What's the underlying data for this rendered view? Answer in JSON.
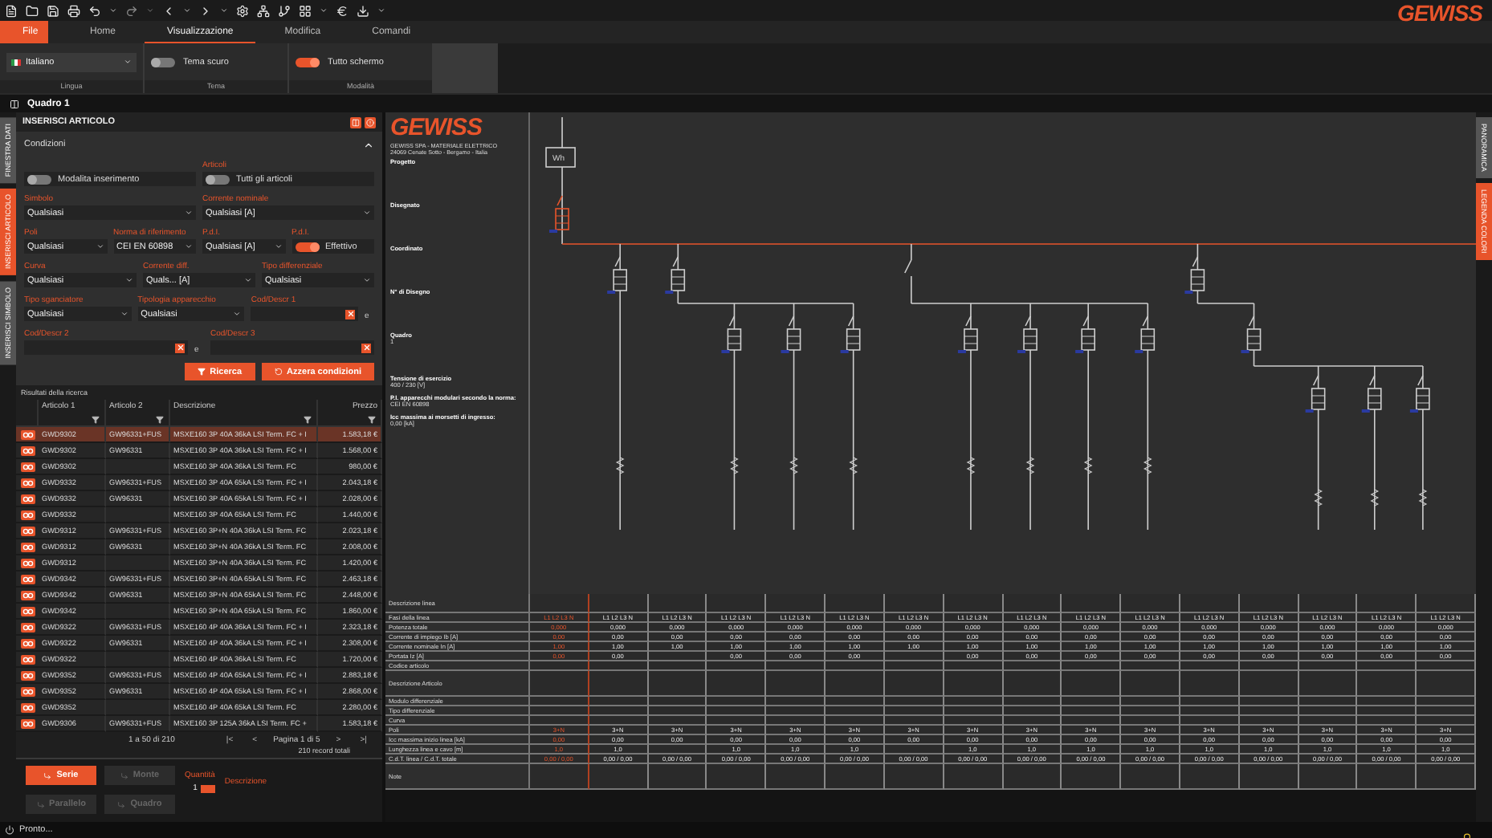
{
  "logo": "GEWISS",
  "ribbon": {
    "tabs": [
      {
        "label": "File",
        "kind": "file",
        "selected": false
      },
      {
        "label": "Home",
        "kind": "tab",
        "selected": false
      },
      {
        "label": "Visualizzazione",
        "kind": "tab",
        "selected": true
      },
      {
        "label": "Modifica",
        "kind": "tab",
        "selected": false
      },
      {
        "label": "Comandi",
        "kind": "tab",
        "selected": false
      }
    ],
    "groups": [
      {
        "label": "Lingua",
        "control": {
          "kind": "select",
          "value": "Italiano"
        }
      },
      {
        "label": "Tema",
        "control": {
          "kind": "toggle",
          "text": "Tema scuro",
          "on": false
        }
      },
      {
        "label": "Modalità",
        "control": {
          "kind": "toggle",
          "text": "Tutto schermo",
          "on": true
        }
      }
    ]
  },
  "document_tab": "Quadro 1",
  "left_tabs": [
    {
      "label": "FINESTRA DATI",
      "selected": false
    },
    {
      "label": "INSERISCI ARTICOLO",
      "selected": true
    },
    {
      "label": "INSERISCI SIMBOLO",
      "selected": false
    }
  ],
  "right_tabs": [
    {
      "label": "PANORAMICA",
      "selected": false
    },
    {
      "label": "LEGENDA COLORI",
      "selected": true
    }
  ],
  "panel": {
    "title": "INSERISCI ARTICOLO",
    "conditions_title": "Condizioni",
    "lines": [
      {
        "fields": [
          {
            "kind": "toggle",
            "text": "Modalita inserimento",
            "on": false
          },
          {
            "kind": "toggle",
            "label": "Articoli",
            "text": "Tutti gli articoli",
            "on": false
          }
        ]
      },
      {
        "fields": [
          {
            "kind": "select",
            "label": "Simbolo",
            "value": "Qualsiasi"
          },
          {
            "kind": "select",
            "label": "Corrente nominale",
            "value": "Qualsiasi [A]"
          }
        ]
      },
      {
        "fields": [
          {
            "kind": "select",
            "label": "Poli",
            "value": "Qualsiasi"
          },
          {
            "kind": "select",
            "label": "Norma di riferimento",
            "value": "CEI EN 60898"
          },
          {
            "kind": "select",
            "label": "P.d.I.",
            "value": "Qualsiasi [A]"
          },
          {
            "kind": "toggle",
            "label": "P.d.I.",
            "text": "Effettivo",
            "on": true
          }
        ]
      },
      {
        "fields": [
          {
            "kind": "select",
            "label": "Curva",
            "value": "Qualsiasi"
          },
          {
            "kind": "select",
            "label": "Corrente diff.",
            "value": "Quals... [A]"
          },
          {
            "kind": "select",
            "label": "Tipo differenziale",
            "value": "Qualsiasi"
          }
        ]
      },
      {
        "fields": [
          {
            "kind": "select",
            "label": "Tipo sganciatore",
            "value": "Qualsiasi"
          },
          {
            "kind": "select",
            "label": "Tipologia apparecchio",
            "value": "Qualsiasi"
          },
          {
            "kind": "text",
            "label": "Cod/Descr 1"
          },
          {
            "kind": "conj",
            "text": "e"
          }
        ]
      },
      {
        "fields": [
          {
            "kind": "text",
            "label": "Cod/Descr 2"
          },
          {
            "kind": "conj",
            "text": "e"
          },
          {
            "kind": "text",
            "label": "Cod/Descr 3"
          }
        ]
      }
    ],
    "buttons": [
      {
        "label": "Ricerca",
        "kind": "search"
      },
      {
        "label": "Azzera condizioni",
        "kind": "reset"
      }
    ],
    "results_title": "Risultati della ricerca",
    "columns": [
      "Articolo 1",
      "Articolo 2",
      "Descrizione",
      "Prezzo"
    ],
    "results": [
      {
        "art1": "GWD9302",
        "art2": "GW96331+FUS",
        "desc": "MSXE160 3P 40A 36kA LSI Term. FC + I",
        "price": "1.583,18 €",
        "selected": true
      },
      {
        "art1": "GWD9302",
        "art2": "GW96331",
        "desc": "MSXE160 3P 40A 36kA LSI Term. FC + I",
        "price": "1.568,00 €",
        "selected": false
      },
      {
        "art1": "GWD9302",
        "desc": "MSXE160 3P 40A 36kA LSI Term. FC",
        "price": "980,00 €",
        "selected": false
      },
      {
        "art1": "GWD9332",
        "art2": "GW96331+FUS",
        "desc": "MSXE160 3P 40A 65kA LSI Term. FC + I",
        "price": "2.043,18 €",
        "selected": false
      },
      {
        "art1": "GWD9332",
        "art2": "GW96331",
        "desc": "MSXE160 3P 40A 65kA LSI Term. FC + I",
        "price": "2.028,00 €",
        "selected": false
      },
      {
        "art1": "GWD9332",
        "desc": "MSXE160 3P 40A 65kA LSI Term. FC",
        "price": "1.440,00 €",
        "selected": false
      },
      {
        "art1": "GWD9312",
        "art2": "GW96331+FUS",
        "desc": "MSXE160 3P+N 40A 36kA LSI Term. FC",
        "price": "2.023,18 €",
        "selected": false
      },
      {
        "art1": "GWD9312",
        "art2": "GW96331",
        "desc": "MSXE160 3P+N 40A 36kA LSI Term. FC",
        "price": "2.008,00 €",
        "selected": false
      },
      {
        "art1": "GWD9312",
        "desc": "MSXE160 3P+N 40A 36kA LSI Term. FC",
        "price": "1.420,00 €",
        "selected": false
      },
      {
        "art1": "GWD9342",
        "art2": "GW96331+FUS",
        "desc": "MSXE160 3P+N 40A 65kA LSI Term. FC",
        "price": "2.463,18 €",
        "selected": false
      },
      {
        "art1": "GWD9342",
        "art2": "GW96331",
        "desc": "MSXE160 3P+N 40A 65kA LSI Term. FC",
        "price": "2.448,00 €",
        "selected": false
      },
      {
        "art1": "GWD9342",
        "desc": "MSXE160 3P+N 40A 65kA LSI Term. FC",
        "price": "1.860,00 €",
        "selected": false
      },
      {
        "art1": "GWD9322",
        "art2": "GW96331+FUS",
        "desc": "MSXE160 4P 40A 36kA LSI Term. FC + I",
        "price": "2.323,18 €",
        "selected": false
      },
      {
        "art1": "GWD9322",
        "art2": "GW96331",
        "desc": "MSXE160 4P 40A 36kA LSI Term. FC + I",
        "price": "2.308,00 €",
        "selected": false
      },
      {
        "art1": "GWD9322",
        "desc": "MSXE160 4P 40A 36kA LSI Term. FC",
        "price": "1.720,00 €",
        "selected": false
      },
      {
        "art1": "GWD9352",
        "art2": "GW96331+FUS",
        "desc": "MSXE160 4P 40A 65kA LSI Term. FC + I",
        "price": "2.883,18 €",
        "selected": false
      },
      {
        "art1": "GWD9352",
        "art2": "GW96331",
        "desc": "MSXE160 4P 40A 65kA LSI Term. FC + I",
        "price": "2.868,00 €",
        "selected": false
      },
      {
        "art1": "GWD9352",
        "desc": "MSXE160 4P 40A 65kA LSI Term. FC",
        "price": "2.280,00 €",
        "selected": false
      },
      {
        "art1": "GWD9306",
        "art2": "GW96331+FUS",
        "desc": "MSXE160 3P 125A 36kA LSI Term. FC +",
        "price": "1.583,18 €",
        "selected": false
      }
    ],
    "pager": {
      "range": "1 a 50 di 210",
      "first": "|<",
      "prev": "<",
      "page": "Pagina 1 di 5",
      "next": ">",
      "last": ">|",
      "total": "210 record totali"
    },
    "connect_buttons": [
      {
        "label": "Serie",
        "selected": true,
        "disabled": false
      },
      {
        "label": "Monte",
        "selected": false,
        "disabled": true
      },
      {
        "label": "Parallelo",
        "selected": false,
        "disabled": true
      },
      {
        "label": "Quadro",
        "selected": false,
        "disabled": true
      }
    ],
    "quantity_label": "Quantità",
    "quantity": "1",
    "description_label": "Descrizione"
  },
  "title_block": {
    "logo": "GEWISS",
    "company": "GEWISS SPA - MATERIALE ELETTRICO",
    "address": "24069 Cenate Sotto - Bergamo - Italia",
    "fields": [
      {
        "label": "Progetto"
      },
      {
        "label": "Disegnato"
      },
      {
        "label": "Coordinato"
      },
      {
        "label": "N° di Disegno"
      },
      {
        "label": "Quadro",
        "value": "1"
      }
    ],
    "specs": [
      {
        "label": "Tensione di esercizio",
        "value": "400 / 230 [V]"
      },
      {
        "label": "P.I. apparecchi modulari secondo la norma:",
        "value": "CEI EN 60898"
      },
      {
        "label": "Icc massima ai morsetti di ingresso:",
        "value": "0,00 [kA]"
      }
    ]
  },
  "meter_label": "Wh",
  "line_table": {
    "rows": [
      {
        "label": "Descrizione linea",
        "kind": "tall"
      },
      {
        "label": "Fasi della linea",
        "kind": "value"
      },
      {
        "label": "Potenza totale",
        "kind": "value"
      },
      {
        "label": "Corrente di impiego Ib [A]",
        "kind": "value"
      },
      {
        "label": "Corrente nominale In [A]",
        "kind": "value"
      },
      {
        "label": "Portata Iz [A]",
        "kind": "value"
      },
      {
        "label": "Codice articolo",
        "kind": "value"
      },
      {
        "label": "Descrizione Articolo",
        "kind": "tall"
      },
      {
        "label": "Modulo differenziale",
        "kind": "value"
      },
      {
        "label": "Tipo differenziale",
        "kind": "value"
      },
      {
        "label": "Curva",
        "kind": "value"
      },
      {
        "label": "Poli",
        "kind": "value"
      },
      {
        "label": "Icc massima inizio linea [kA]",
        "kind": "value"
      },
      {
        "label": "Lunghezza linea e cavo [m]",
        "kind": "value"
      },
      {
        "label": "C.d.T. linea / C.d.T. totale",
        "kind": "value"
      },
      {
        "label": "Note",
        "kind": "tall"
      }
    ],
    "columns": [
      {
        "selected": true,
        "cells": [
          "L1 L2 L3 N",
          "0,000",
          "0,00",
          "1,00",
          "0,00",
          null,
          null,
          null,
          null,
          "3+N",
          "0,00",
          "1,0",
          "0,00 / 0,00"
        ]
      },
      {
        "selected": false,
        "cells": [
          "L1 L2 L3 N",
          "0,000",
          "0,00",
          "1,00",
          "0,00",
          null,
          null,
          null,
          null,
          "3+N",
          "0,00",
          "1,0",
          "0,00 / 0,00"
        ]
      },
      {
        "selected": false,
        "cells": [
          "L1 L2 L3 N",
          "0,000",
          "0,00",
          "1,00",
          null,
          null,
          null,
          null,
          null,
          "3+N",
          "0,00",
          null,
          "0,00 / 0,00"
        ]
      },
      {
        "selected": false,
        "cells": [
          "L1 L2 L3 N",
          "0,000",
          "0,00",
          "1,00",
          "0,00",
          null,
          null,
          null,
          null,
          "3+N",
          "0,00",
          "1,0",
          "0,00 / 0,00"
        ]
      },
      {
        "selected": false,
        "cells": [
          "L1 L2 L3 N",
          "0,000",
          "0,00",
          "1,00",
          "0,00",
          null,
          null,
          null,
          null,
          "3+N",
          "0,00",
          "1,0",
          "0,00 / 0,00"
        ]
      },
      {
        "selected": false,
        "cells": [
          "L1 L2 L3 N",
          "0,000",
          "0,00",
          "1,00",
          "0,00",
          null,
          null,
          null,
          null,
          "3+N",
          "0,00",
          "1,0",
          "0,00 / 0,00"
        ]
      },
      {
        "selected": false,
        "cells": [
          "L1 L2 L3 N",
          "0,000",
          "0,00",
          "1,00",
          null,
          null,
          null,
          null,
          null,
          "3+N",
          "0,00",
          null,
          "0,00 / 0,00"
        ]
      },
      {
        "selected": false,
        "cells": [
          "L1 L2 L3 N",
          "0,000",
          "0,00",
          "1,00",
          "0,00",
          null,
          null,
          null,
          null,
          "3+N",
          "0,00",
          "1,0",
          "0,00 / 0,00"
        ]
      },
      {
        "selected": false,
        "cells": [
          "L1 L2 L3 N",
          "0,000",
          "0,00",
          "1,00",
          "0,00",
          null,
          null,
          null,
          null,
          "3+N",
          "0,00",
          "1,0",
          "0,00 / 0,00"
        ]
      },
      {
        "selected": false,
        "cells": [
          "L1 L2 L3 N",
          "0,000",
          "0,00",
          "1,00",
          "0,00",
          null,
          null,
          null,
          null,
          "3+N",
          "0,00",
          "1,0",
          "0,00 / 0,00"
        ]
      },
      {
        "selected": false,
        "cells": [
          "L1 L2 L3 N",
          "0,000",
          "0,00",
          "1,00",
          "0,00",
          null,
          null,
          null,
          null,
          "3+N",
          "0,00",
          "1,0",
          "0,00 / 0,00"
        ]
      },
      {
        "selected": false,
        "cells": [
          "L1 L2 L3 N",
          "0,000",
          "0,00",
          "1,00",
          "0,00",
          null,
          null,
          null,
          null,
          "3+N",
          "0,00",
          "1,0",
          "0,00 / 0,00"
        ]
      },
      {
        "selected": false,
        "cells": [
          "L1 L2 L3 N",
          "0,000",
          "0,00",
          "1,00",
          "0,00",
          null,
          null,
          null,
          null,
          "3+N",
          "0,00",
          "1,0",
          "0,00 / 0,00"
        ]
      },
      {
        "selected": false,
        "cells": [
          "L1 L2 L3 N",
          "0,000",
          "0,00",
          "1,00",
          "0,00",
          null,
          null,
          null,
          null,
          "3+N",
          "0,00",
          "1,0",
          "0,00 / 0,00"
        ]
      },
      {
        "selected": false,
        "cells": [
          "L1 L2 L3 N",
          "0,000",
          "0,00",
          "1,00",
          "0,00",
          null,
          null,
          null,
          null,
          "3+N",
          "0,00",
          "1,0",
          "0,00 / 0,00"
        ]
      },
      {
        "selected": false,
        "cells": [
          "L1 L2 L3 N",
          "0,000",
          "0,00",
          "1,00",
          "0,00",
          null,
          null,
          null,
          null,
          "3+N",
          "0,00",
          "1,0",
          "0,00 / 0,00"
        ]
      }
    ]
  },
  "status": "Pronto..."
}
